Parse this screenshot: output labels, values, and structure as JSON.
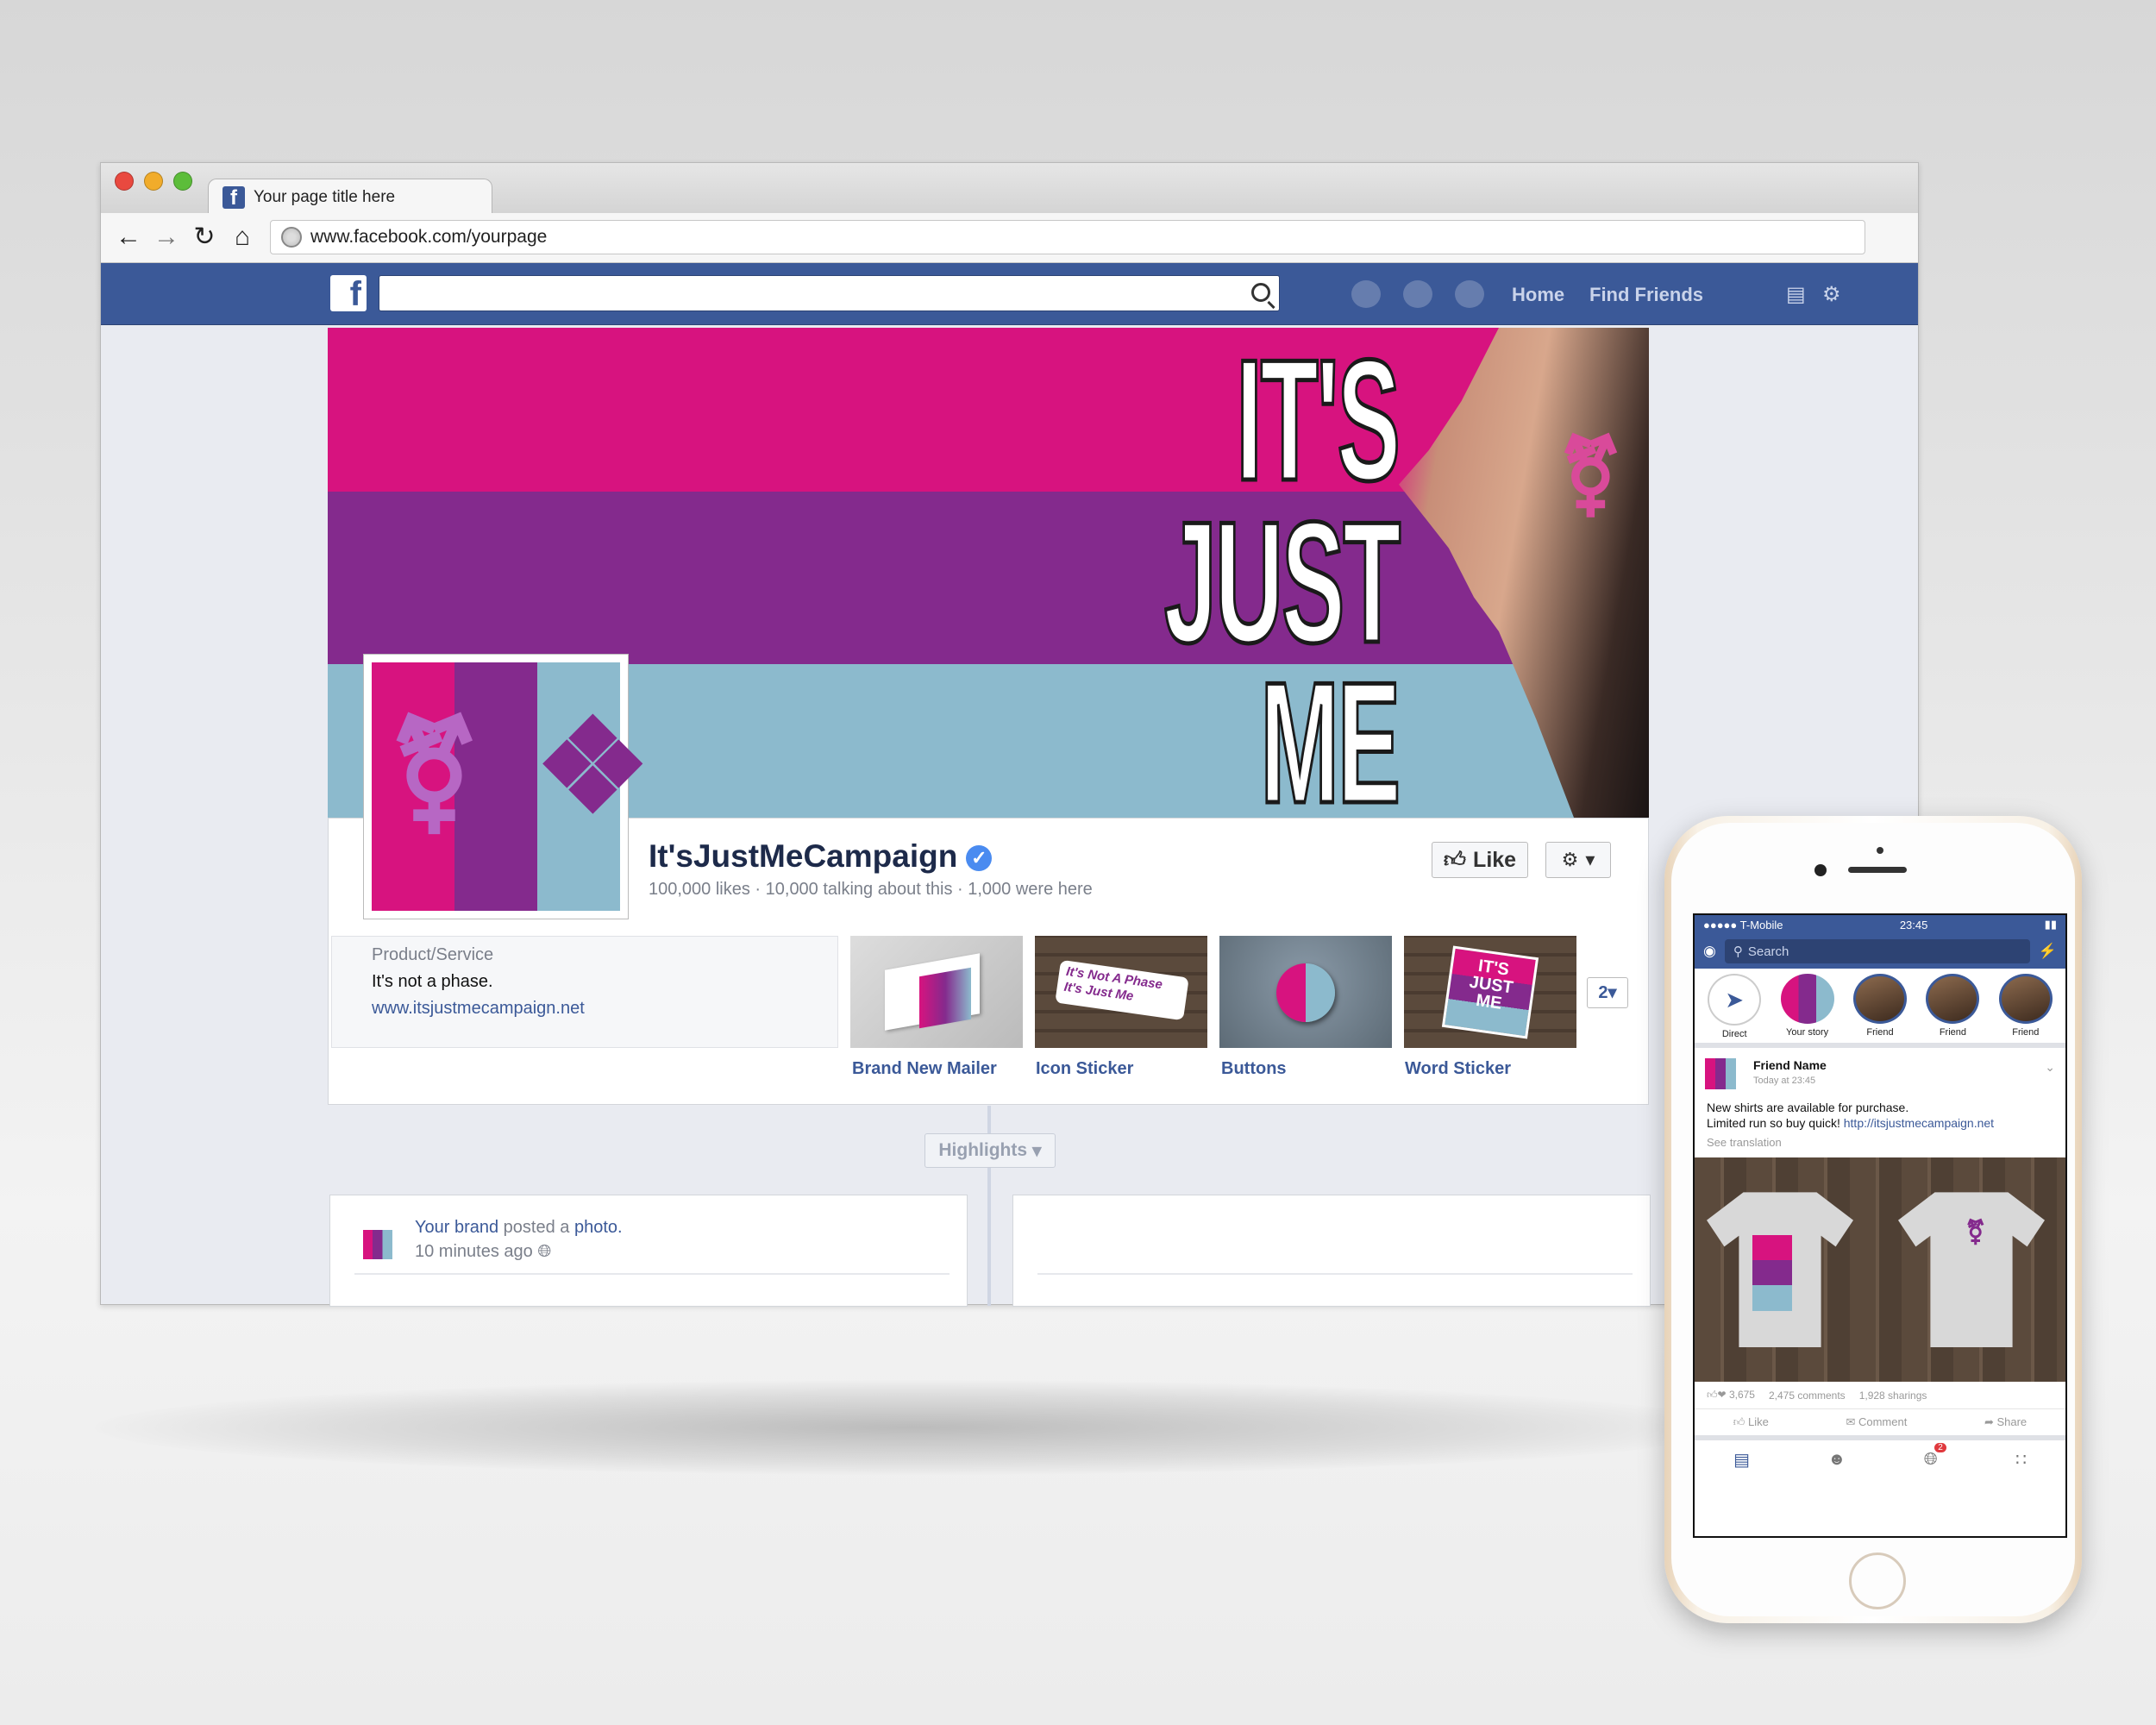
{
  "browser": {
    "tab_title": "Your page title here",
    "url": "www.facebook.com/yourpage"
  },
  "fb_header": {
    "logo": "f",
    "home": "Home",
    "find_friends": "Find Friends"
  },
  "cover": {
    "line1": "IT'S",
    "line2": "JUST",
    "line3": "ME",
    "colors": [
      "#d7137f",
      "#842a8d",
      "#8cbacd"
    ]
  },
  "page": {
    "name": "It'sJustMeCampaign",
    "stats": "100,000 likes · 10,000 talking about this · 1,000 were here",
    "like_label": "Like"
  },
  "about": {
    "type": "Product/Service",
    "description": "It's not a phase.",
    "website": "www.itsjustmecampaign.net"
  },
  "apps": [
    {
      "label": "Brand New Mailer"
    },
    {
      "label": "Icon Sticker"
    },
    {
      "label": "Buttons"
    },
    {
      "label": "Word Sticker"
    }
  ],
  "apps_more": "2",
  "sticker_text": "It's Not A Phase It's Just Me",
  "highlights_label": "Highlights",
  "post": {
    "author": "Your brand",
    "action": " posted a ",
    "object": "photo.",
    "time": "10 minutes ago"
  },
  "mobile": {
    "carrier": "●●●●● T-Mobile",
    "clock": "23:45",
    "search_placeholder": "Search",
    "stories": [
      "Direct",
      "Your story",
      "Friend",
      "Friend",
      "Friend"
    ],
    "post_name": "Friend Name",
    "post_time": "Today at 23:45",
    "post_text_1": "New shirts are available for purchase.",
    "post_text_2": "Limited run so buy quick! ",
    "post_link": "http://itsjustmecampaign.net",
    "see_translation": "See translation",
    "reactions": "3,675",
    "comments": "2,475 comments",
    "sharings": "1,928 sharings",
    "action_like": "Like",
    "action_comment": "Comment",
    "action_share": "Share",
    "notif_count": "2"
  }
}
